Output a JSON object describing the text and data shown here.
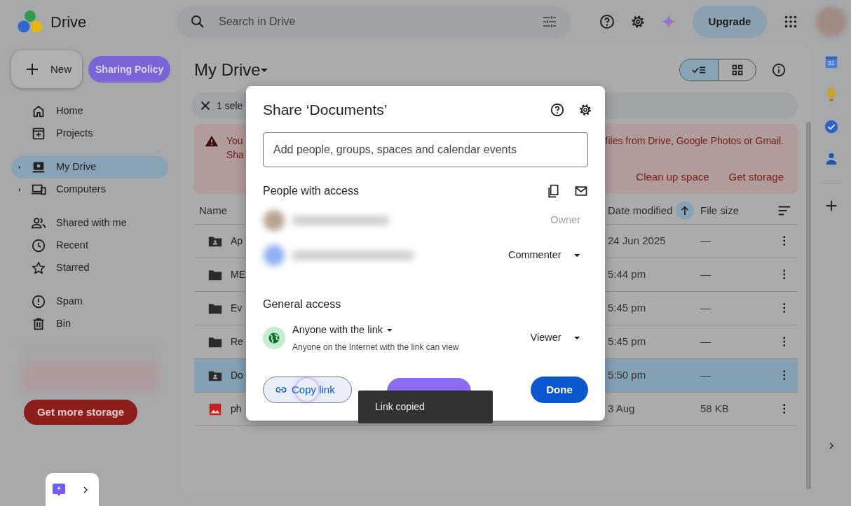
{
  "app": {
    "name": "Drive"
  },
  "search": {
    "placeholder": "Search in Drive"
  },
  "header": {
    "upgrade": "Upgrade"
  },
  "sidebar": {
    "new_button": "New",
    "policy_button": "Sharing Policy",
    "sections": [
      {
        "items": [
          {
            "label": "Home",
            "selected": false,
            "has_children": false
          },
          {
            "label": "Projects",
            "selected": false,
            "has_children": false
          }
        ]
      },
      {
        "items": [
          {
            "label": "My Drive",
            "selected": true,
            "has_children": true
          },
          {
            "label": "Computers",
            "selected": false,
            "has_children": true
          }
        ]
      },
      {
        "items": [
          {
            "label": "Shared with me",
            "selected": false,
            "has_children": false
          },
          {
            "label": "Recent",
            "selected": false,
            "has_children": false
          },
          {
            "label": "Starred",
            "selected": false,
            "has_children": false
          }
        ]
      },
      {
        "items": [
          {
            "label": "Spam",
            "selected": false,
            "has_children": false
          },
          {
            "label": "Bin",
            "selected": false,
            "has_children": false
          }
        ]
      }
    ],
    "storage_button": "Get more storage"
  },
  "main": {
    "title": "My Drive",
    "views": [
      {
        "kind": "list",
        "selected": true
      },
      {
        "kind": "grid",
        "selected": false
      }
    ],
    "selection_bar": {
      "count": "1 sele"
    },
    "banner": {
      "lines": [
        "You",
        "Sha"
      ],
      "right_text": "files from Drive, Google Photos or Gmail.",
      "actions": [
        "Clean up space",
        "Get storage"
      ]
    },
    "table": {
      "columns": [
        {
          "label": "Name",
          "sorted": false
        },
        {
          "label": "Date modified",
          "sorted": true
        },
        {
          "label": "File size",
          "sorted": false
        }
      ],
      "rows": [
        {
          "kind": "shared-folder",
          "name": "Ap",
          "date": "24 Jun 2025",
          "size": "—",
          "selected": false
        },
        {
          "kind": "folder",
          "name": "ME",
          "date": "5:44 pm",
          "size": "—",
          "selected": false
        },
        {
          "kind": "folder",
          "name": "Ev",
          "date": "5:45 pm",
          "size": "—",
          "selected": false
        },
        {
          "kind": "folder",
          "name": "Re",
          "date": "5:45 pm",
          "size": "—",
          "selected": false
        },
        {
          "kind": "shared-folder",
          "name": "Do",
          "date": "5:50 pm",
          "size": "—",
          "selected": true
        },
        {
          "kind": "image",
          "name": "ph",
          "date": "3 Aug",
          "size": "58 KB",
          "selected": false
        }
      ]
    }
  },
  "rail": {
    "calendar_day": "31"
  },
  "dialog": {
    "title": "Share ‘Documents’",
    "input_placeholder": "Add people, groups, spaces and calendar events",
    "people_heading": "People with access",
    "people": [
      {
        "role": "Owner",
        "role_editable": false
      },
      {
        "role": "Commenter",
        "role_editable": true
      }
    ],
    "general_heading": "General access",
    "access": {
      "label": "Anyone with the link",
      "description": "Anyone on the Internet with the link can view",
      "role": "Viewer"
    },
    "buttons": [
      {
        "kind": "copy",
        "label": "Copy link",
        "focused": true
      },
      {
        "kind": "policy",
        "focused": false
      },
      {
        "kind": "done",
        "label": "Done",
        "focused": false
      }
    ]
  },
  "toast": {
    "text": "Link copied"
  }
}
